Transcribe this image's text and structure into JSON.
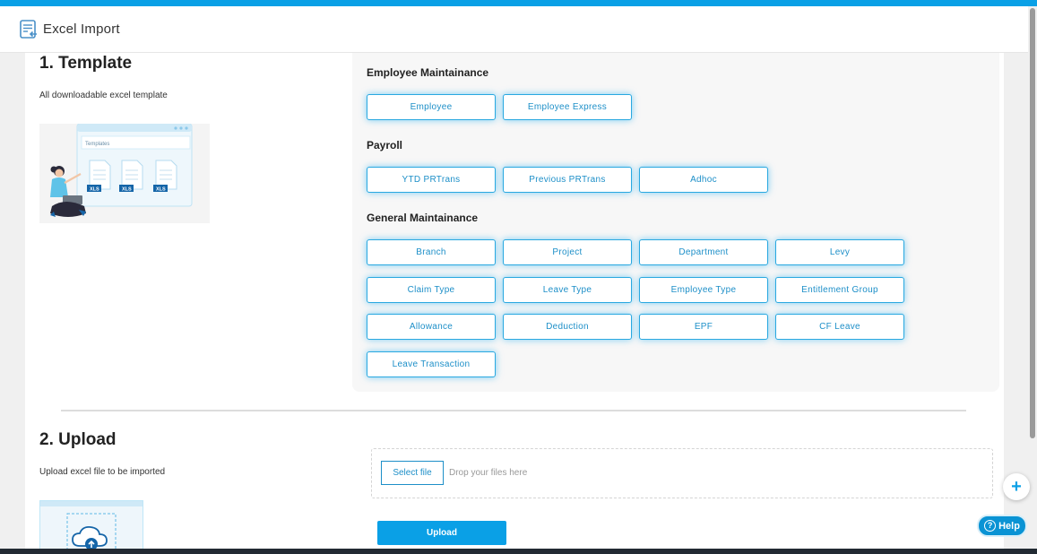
{
  "header": {
    "title": "Excel Import",
    "icon": "import-sheet-icon"
  },
  "template_section": {
    "title": "1. Template",
    "subtitle": "All downloadable excel template",
    "illustration": {
      "window_label": "Templates",
      "file_badges": [
        "XLS",
        "XLS",
        "XLS"
      ]
    },
    "groups": [
      {
        "title": "Employee Maintainance",
        "buttons": [
          "Employee",
          "Employee Express"
        ]
      },
      {
        "title": "Payroll",
        "buttons": [
          "YTD PRTrans",
          "Previous PRTrans",
          "Adhoc"
        ]
      },
      {
        "title": "General Maintainance",
        "buttons": [
          "Branch",
          "Project",
          "Department",
          "Levy",
          "Claim Type",
          "Leave Type",
          "Employee Type",
          "Entitlement Group",
          "Allowance",
          "Deduction",
          "EPF",
          "CF Leave",
          "Leave Transaction"
        ]
      }
    ]
  },
  "upload_section": {
    "title": "2. Upload",
    "subtitle": "Upload excel file to be imported",
    "select_file_label": "Select file",
    "drop_hint": "Drop your files here",
    "upload_label": "Upload"
  },
  "floating": {
    "plus_label": "+",
    "help_label": "Help",
    "help_icon": "?"
  },
  "colors": {
    "accent": "#0aa0e6",
    "button_text": "#1d8fc8",
    "panel_bg": "#f7f7f7"
  }
}
